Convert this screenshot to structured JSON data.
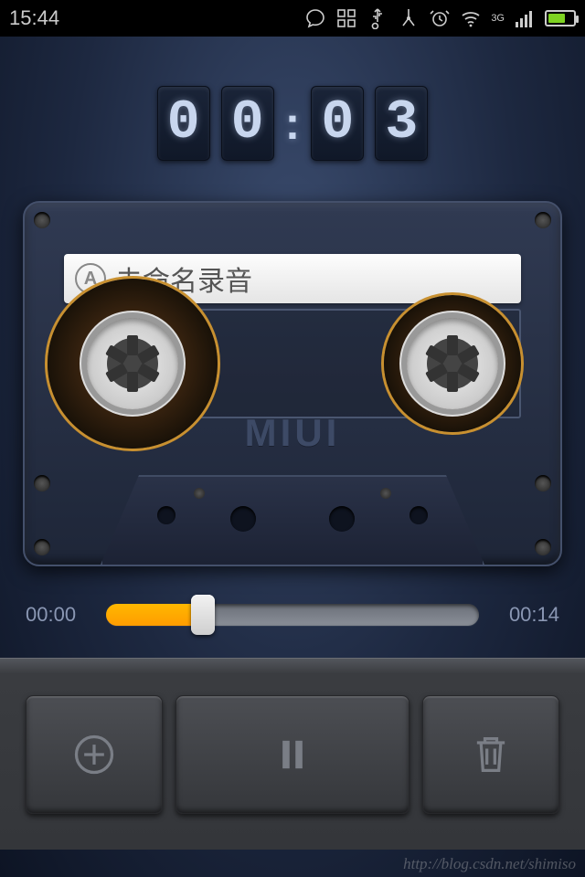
{
  "status": {
    "time": "15:44",
    "network_type": "3G"
  },
  "timer": {
    "d1": "0",
    "d2": "0",
    "d3": "0",
    "d4": "3"
  },
  "cassette": {
    "side": "A",
    "title": "未命名录音",
    "brand": "MIUI"
  },
  "progress": {
    "elapsed": "00:00",
    "total": "00:14",
    "percent": 26
  },
  "watermark": "http://blog.csdn.net/shimiso"
}
